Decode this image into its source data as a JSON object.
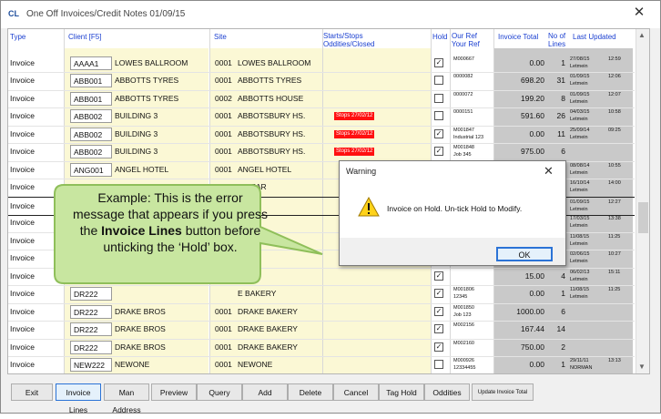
{
  "window": {
    "app_icon": "CL",
    "title": "One Off Invoices/Credit Notes 01/09/15",
    "close_glyph": "✕"
  },
  "columns": {
    "type": "Type",
    "client": "Client [F5]",
    "site": "Site",
    "starts_1": "Starts/Stops",
    "starts_2": "Oddities/Closed",
    "hold": "Hold",
    "ref_1": "Our Ref",
    "ref_2": "Your Ref",
    "total": "Invoice Total",
    "lines_1": "No of",
    "lines_2": "Lines",
    "updated": "Last Updated"
  },
  "rows": [
    {
      "type": "Invoice",
      "code": "AAAA1",
      "client": "LOWES BALLROOM",
      "site_no": "0001",
      "site": "LOWES BALLROOM",
      "stop": "",
      "hold": true,
      "ref": "M000667",
      "total": "0.00",
      "lines": "1",
      "upd_date": "27/08/15\nLetmein",
      "upd_time": "12:59"
    },
    {
      "type": "Invoice",
      "code": "ABB001",
      "client": "ABBOTTS TYRES",
      "site_no": "0001",
      "site": "ABBOTTS TYRES",
      "stop": "",
      "hold": false,
      "ref": "0000082",
      "total": "698.20",
      "lines": "31",
      "upd_date": "01/09/15\nLetmein",
      "upd_time": "12:06"
    },
    {
      "type": "Invoice",
      "code": "ABB001",
      "client": "ABBOTTS TYRES",
      "site_no": "0002",
      "site": "ABBOTTS HOUSE",
      "stop": "",
      "hold": false,
      "ref": "0000072",
      "total": "199.20",
      "lines": "8",
      "upd_date": "01/09/15\nLetmein",
      "upd_time": "12:07"
    },
    {
      "type": "Invoice",
      "code": "ABB002",
      "client": "BUILDING 3",
      "site_no": "0001",
      "site": "ABBOTSBURY HS.",
      "stop": "Stops 27/02/12",
      "hold": false,
      "ref": "0000151",
      "total": "591.60",
      "lines": "26",
      "upd_date": "04/03/15\nLetmein",
      "upd_time": "10:58"
    },
    {
      "type": "Invoice",
      "code": "ABB002",
      "client": "BUILDING 3",
      "site_no": "0001",
      "site": "ABBOTSBURY HS.",
      "stop": "Stops 27/02/12",
      "hold": true,
      "ref": "M001847\nIndustrial 123",
      "total": "0.00",
      "lines": "11",
      "upd_date": "25/09/14\nLetmein",
      "upd_time": "09:25"
    },
    {
      "type": "Invoice",
      "code": "ABB002",
      "client": "BUILDING 3",
      "site_no": "0001",
      "site": "ABBOTSBURY HS.",
      "stop": "Stops 27/02/12",
      "hold": true,
      "ref": "M001848\nJob 345",
      "total": "975.00",
      "lines": "6",
      "upd_date": "",
      "upd_time": ""
    },
    {
      "type": "Invoice",
      "code": "ANG001",
      "client": "ANGEL HOTEL",
      "site_no": "0001",
      "site": "ANGEL HOTEL",
      "stop": "",
      "hold": false,
      "ref": "",
      "total": "",
      "lines": "1",
      "upd_date": "08/08/14\nLetmein",
      "upd_time": "10:55"
    },
    {
      "type": "Invoice",
      "code": "",
      "client": "",
      "site_no": "",
      "site": "D PEAR",
      "stop": "",
      "hold": false,
      "ref": "",
      "total": "",
      "lines": "57",
      "upd_date": "16/10/14\nLetmein",
      "upd_time": "14:00"
    },
    {
      "type": "Invoice",
      "code": "",
      "client": "",
      "site_no": "",
      "site": "PEAR",
      "stop": "",
      "hold": false,
      "ref": "",
      "total": "",
      "lines": "1",
      "upd_date": "01/09/15\nLetmein",
      "upd_time": "12:27"
    },
    {
      "type": "Invoice",
      "code": "",
      "client": "",
      "site_no": "",
      "site": "TON",
      "stop": "",
      "hold": false,
      "ref": "",
      "total": "",
      "lines": "52",
      "upd_date": "17/03/15\nLetmein",
      "upd_time": "13:38"
    },
    {
      "type": "Invoice",
      "code": "",
      "client": "",
      "site_no": "",
      "site": "KERY",
      "stop": "",
      "hold": false,
      "ref": "",
      "total": "",
      "lines": "1",
      "upd_date": "11/08/15\nLetmein",
      "upd_time": "11:25"
    },
    {
      "type": "Invoice",
      "code": "",
      "client": "",
      "site_no": "",
      "site": "",
      "stop": "",
      "hold": false,
      "ref": "",
      "total": "",
      "lines": "3",
      "upd_date": "02/06/15\nLetmein",
      "upd_time": "10:27"
    },
    {
      "type": "Invoice",
      "code": "",
      "client": "",
      "site_no": "",
      "site": "KERY",
      "stop": "",
      "hold": true,
      "ref": "",
      "total": "15.00",
      "lines": "4",
      "upd_date": "06/02/13\nLetmein",
      "upd_time": "15:11"
    },
    {
      "type": "Invoice",
      "code": "DR222",
      "client": "",
      "site_no": "",
      "site": "E BAKERY",
      "stop": "",
      "hold": true,
      "ref": "M001806\n12345",
      "total": "0.00",
      "lines": "1",
      "upd_date": "11/08/15\nLetmein",
      "upd_time": "11:25"
    },
    {
      "type": "Invoice",
      "code": "DR222",
      "client": "DRAKE BROS",
      "site_no": "0001",
      "site": "DRAKE BAKERY",
      "stop": "",
      "hold": true,
      "ref": "M001850\nJob 123",
      "total": "1000.00",
      "lines": "6",
      "upd_date": "",
      "upd_time": ""
    },
    {
      "type": "Invoice",
      "code": "DR222",
      "client": "DRAKE BROS",
      "site_no": "0001",
      "site": "DRAKE BAKERY",
      "stop": "",
      "hold": true,
      "ref": "M002156",
      "total": "167.44",
      "lines": "14",
      "upd_date": "",
      "upd_time": ""
    },
    {
      "type": "Invoice",
      "code": "DR222",
      "client": "DRAKE BROS",
      "site_no": "0001",
      "site": "DRAKE BAKERY",
      "stop": "",
      "hold": true,
      "ref": "M002160",
      "total": "750.00",
      "lines": "2",
      "upd_date": "",
      "upd_time": ""
    },
    {
      "type": "Invoice",
      "code": "NEW222",
      "client": "NEWONE",
      "site_no": "0001",
      "site": "NEWONE",
      "stop": "",
      "hold": false,
      "ref": "M000926\n12334455",
      "total": "0.00",
      "lines": "1",
      "upd_date": "29/11/11\nNORMAN",
      "upd_time": "13:13"
    }
  ],
  "toolbar": {
    "exit": "Exit",
    "invoice_lines": "Invoice Lines",
    "man_address": "Man Address",
    "preview": "Preview",
    "query": "Query",
    "add": "Add",
    "delete": "Delete",
    "cancel": "Cancel",
    "tag_hold": "Tag Hold",
    "oddities": "Oddities",
    "update_total": "Update Invoice Total"
  },
  "warning": {
    "title": "Warning",
    "message": "Invoice on Hold. Un-tick Hold to Modify.",
    "ok": "OK",
    "close_glyph": "✕",
    "icon": "warning-triangle-icon"
  },
  "callout": {
    "text_before": "Example: This is the error message that appears if you press the ",
    "bold_1": "Invoice Lines",
    "text_middle": " button before unticking the ‘Hold’ box."
  },
  "colors": {
    "header_blue": "#1a3fd0",
    "yellow_cells": "#fbf8d5",
    "grey_cells": "#c9c9c9",
    "stop_red": "#ff1010",
    "callout_fill": "#c8e6a0",
    "callout_border": "#8fbf5a",
    "focus_blue": "#2b73d6"
  }
}
